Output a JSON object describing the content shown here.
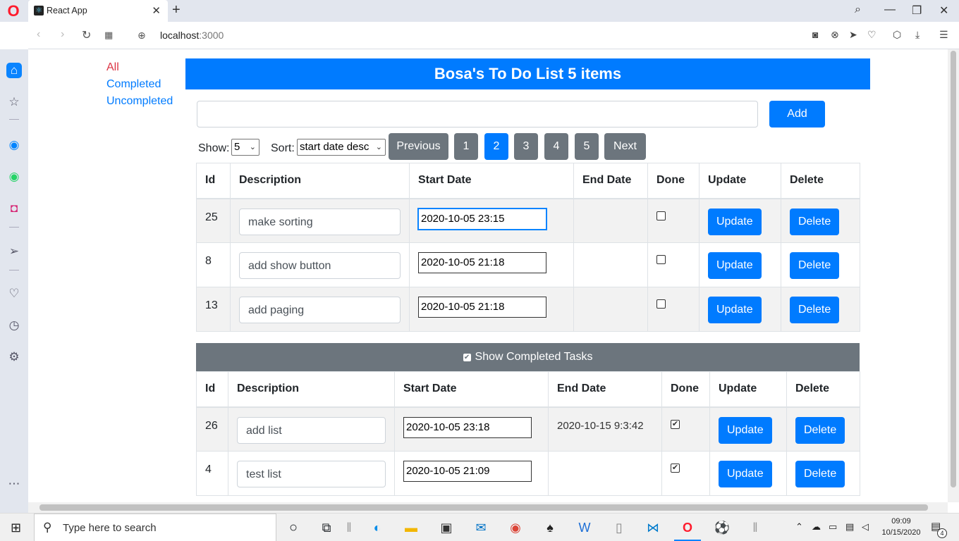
{
  "browser": {
    "tab_title": "React App",
    "url_host": "localhost",
    "url_port": ":3000"
  },
  "filters": {
    "all": "All",
    "completed": "Completed",
    "uncompleted": "Uncompleted"
  },
  "header": {
    "title": "Bosa's To Do List 5 items"
  },
  "add_form": {
    "value": "",
    "add_label": "Add"
  },
  "controls": {
    "show_label": "Show:",
    "show_value": "5",
    "sort_label": "Sort:",
    "sort_value": "start date desc",
    "previous_label": "Previous",
    "next_label": "Next",
    "pages": [
      "1",
      "2",
      "3",
      "4",
      "5"
    ],
    "active_page": "2"
  },
  "columns": [
    "Id",
    "Description",
    "Start Date",
    "End Date",
    "Done",
    "Update",
    "Delete"
  ],
  "buttons": {
    "update": "Update",
    "delete": "Delete"
  },
  "tasks": [
    {
      "id": "25",
      "description": "make sorting",
      "start_date": "2020-10-05 23:15",
      "end_date": "",
      "done": false
    },
    {
      "id": "8",
      "description": "add show button",
      "start_date": "2020-10-05 21:18",
      "end_date": "",
      "done": false
    },
    {
      "id": "13",
      "description": "add paging",
      "start_date": "2020-10-05 21:18",
      "end_date": "",
      "done": false
    }
  ],
  "completed_toggle": {
    "label": "Show Completed Tasks",
    "checked": true
  },
  "completed_tasks": [
    {
      "id": "26",
      "description": "add list",
      "start_date": "2020-10-05 23:18",
      "end_date": "2020-10-15 9:3:42",
      "done": true
    },
    {
      "id": "4",
      "description": "test list",
      "start_date": "2020-10-05 21:09",
      "end_date": "",
      "done": true
    }
  ],
  "taskbar": {
    "search_placeholder": "Type here to search",
    "time": "09:09",
    "date": "10/15/2020",
    "notification_count": "4"
  }
}
